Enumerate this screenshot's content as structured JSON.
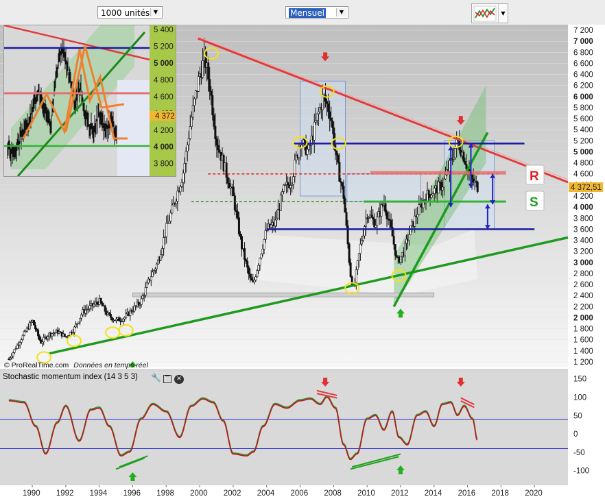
{
  "toolbar": {
    "units_select": "1000 unités",
    "period_select": "Mensuel",
    "chart_type_icon": "chart-type-icon"
  },
  "watermark": {
    "brand": "ProRealTime.com",
    "note": "Données en temps réel"
  },
  "last_price_label": "4 372,51",
  "inset_last_price": "4 372",
  "resistance_label": "R",
  "support_label": "S",
  "indicator": {
    "title": "Stochastic momentum index (14 3 5 3)",
    "icons": [
      "wrench-icon",
      "window-icon",
      "close-icon"
    ]
  },
  "colors": {
    "resistance": "#e23a3a",
    "support": "#1e9a1e",
    "channel": "#1a1aa0",
    "inset_pattern": "#f08030",
    "price": "#111111"
  },
  "chart_data": [
    {
      "type": "candlestick",
      "name": "main",
      "x_ticks": [
        "1990",
        "1992",
        "1994",
        "1996",
        "1998",
        "2000",
        "2002",
        "2004",
        "2006",
        "2008",
        "2010",
        "2012",
        "2014",
        "2016",
        "2018",
        "2020"
      ],
      "y_ticks": [
        1200,
        1400,
        1600,
        1800,
        2000,
        2200,
        2400,
        2600,
        2800,
        3000,
        3200,
        3400,
        3600,
        3800,
        4000,
        4200,
        4400,
        4600,
        4800,
        5000,
        5200,
        5400,
        5600,
        5800,
        6000,
        6200,
        6400,
        6600,
        6800,
        7000,
        7200
      ],
      "y_tick_labels": [
        "1 200",
        "1 400",
        "1 600",
        "1 800",
        "2 000",
        "2 200",
        "2 400",
        "2 600",
        "2 800",
        "3 000",
        "3 200",
        "3 400",
        "3 600",
        "3 800",
        "4 000",
        "4 200",
        "4 400",
        "4 600",
        "4 800",
        "5 000",
        "5 200",
        "5 400",
        "5 600",
        "5 800",
        "6 000",
        "6 200",
        "6 400",
        "6 600",
        "6 800",
        "7 000",
        "7 200"
      ],
      "y_bold_ticks": [
        2000,
        3000,
        4000,
        5000,
        6000,
        7000
      ],
      "ylim": [
        1100,
        7300
      ],
      "xlim": [
        1988.4,
        2022.0
      ],
      "last_price": 4372.51,
      "series": {
        "dates": [
          1988.6,
          1989.0,
          1989.5,
          1990.0,
          1990.5,
          1991.0,
          1991.5,
          1992.0,
          1992.5,
          1993.0,
          1993.5,
          1994.0,
          1994.5,
          1995.0,
          1995.5,
          1996.0,
          1996.5,
          1997.0,
          1997.5,
          1998.0,
          1998.5,
          1999.0,
          1999.5,
          2000.0,
          2000.3,
          2000.6,
          2001.0,
          2001.5,
          2002.0,
          2002.5,
          2003.0,
          2003.2,
          2003.6,
          2004.0,
          2004.5,
          2005.0,
          2005.5,
          2006.0,
          2006.5,
          2007.0,
          2007.4,
          2007.8,
          2008.2,
          2008.6,
          2009.0,
          2009.2,
          2009.6,
          2010.0,
          2010.5,
          2011.0,
          2011.5,
          2011.8,
          2012.2,
          2012.6,
          2013.0,
          2013.5,
          2014.0,
          2014.5,
          2015.0,
          2015.4,
          2015.8,
          2016.2,
          2016.6
        ],
        "close": [
          1250,
          1450,
          1700,
          1950,
          1550,
          1700,
          1750,
          1650,
          1800,
          2100,
          2200,
          2300,
          2050,
          1950,
          2000,
          2150,
          2300,
          2700,
          3000,
          3600,
          4100,
          4600,
          5600,
          6400,
          6700,
          6200,
          5200,
          4700,
          4200,
          3300,
          2700,
          2600,
          3100,
          3600,
          3700,
          4300,
          4500,
          5200,
          5000,
          5600,
          6000,
          5700,
          4800,
          4200,
          2800,
          2500,
          3300,
          3900,
          3700,
          4100,
          3500,
          3000,
          3200,
          3600,
          3900,
          4200,
          4300,
          4400,
          4800,
          5200,
          4900,
          4500,
          4372
        ]
      },
      "annotations": {
        "resistance_line": {
          "from": [
            1999.9,
            7050
          ],
          "to": [
            2022.0,
            4450
          ]
        },
        "support_line": {
          "from": [
            1991.0,
            1350
          ],
          "to": [
            2022.0,
            3450
          ]
        },
        "uptrend_line": {
          "from": [
            2011.6,
            2200
          ],
          "to": [
            2017.2,
            5350
          ]
        },
        "channel_top": {
          "y": 5150,
          "from": 2005.6,
          "to": 2019.4
        },
        "channel_bottom": {
          "y": 3600,
          "from": 2004.0,
          "to": 2020.0
        },
        "red_dashed": {
          "y": 4600,
          "from": 2000.5,
          "to": 2018.0
        },
        "green_dashed": {
          "y": 4100,
          "from": 1999.5,
          "to": 2018.0
        },
        "red_zone": {
          "y": 4620,
          "from": 2010.2,
          "to": 2018.3
        },
        "green_zone": {
          "y": 4100,
          "from": 2009.8,
          "to": 2018.3
        },
        "down_arrows": [
          2007.5,
          2015.6
        ],
        "up_arrows": [
          1996.0,
          2012.0
        ],
        "circles": [
          [
            1990.7,
            1280
          ],
          [
            1992.5,
            1580
          ],
          [
            1994.8,
            1730
          ],
          [
            1995.6,
            1770
          ],
          [
            2000.7,
            6780
          ],
          [
            2006.0,
            5170
          ],
          [
            2007.6,
            6090
          ],
          [
            2008.3,
            5150
          ],
          [
            2009.1,
            2530
          ],
          [
            2011.9,
            2760
          ],
          [
            2015.3,
            5180
          ]
        ]
      }
    },
    {
      "type": "line",
      "name": "Stochastic momentum index (14 3 5 3)",
      "y_ticks": [
        150,
        100,
        50,
        0,
        -50,
        -100
      ],
      "y_tick_labels": [
        "150",
        "100",
        "50",
        "0",
        "-50",
        "-100"
      ],
      "ylim": [
        -140,
        170
      ],
      "reference_lines": [
        40,
        -40
      ],
      "series": {
        "dates": [
          1988.6,
          1989.5,
          1990.2,
          1990.8,
          1991.5,
          1992.0,
          1992.8,
          1993.5,
          1994.0,
          1994.6,
          1995.3,
          1995.8,
          1996.5,
          1997.2,
          1998.0,
          1998.8,
          1999.5,
          2000.2,
          2000.8,
          2001.4,
          2002.0,
          2002.8,
          2003.2,
          2003.8,
          2004.5,
          2005.2,
          2006.0,
          2006.6,
          2007.2,
          2007.6,
          2008.1,
          2008.6,
          2009.0,
          2009.4,
          2010.0,
          2010.5,
          2011.0,
          2011.5,
          2011.9,
          2012.4,
          2013.0,
          2013.5,
          2014.0,
          2014.5,
          2015.0,
          2015.4,
          2015.8,
          2016.3,
          2016.6
        ],
        "values": [
          90,
          85,
          20,
          -55,
          30,
          75,
          -20,
          65,
          70,
          20,
          -60,
          -50,
          40,
          80,
          60,
          -10,
          75,
          95,
          85,
          35,
          -55,
          -60,
          -50,
          20,
          80,
          70,
          90,
          95,
          80,
          100,
          70,
          -30,
          -70,
          -55,
          40,
          50,
          10,
          60,
          -10,
          -30,
          50,
          60,
          20,
          80,
          85,
          50,
          75,
          40,
          -20
        ]
      }
    },
    {
      "type": "candlestick",
      "name": "inset",
      "y_ticks": [
        3800,
        4000,
        4200,
        4400,
        4600,
        4800,
        5000,
        5200,
        5400
      ],
      "y_tick_labels": [
        "3 800",
        "4 000",
        "4 200",
        "4 400",
        "4 600",
        "4 800",
        "5 000",
        "5 200",
        "5 400"
      ],
      "y_bold_ticks": [
        4000,
        5000
      ],
      "ylim": [
        3650,
        5450
      ],
      "last_price": 4372
    }
  ]
}
